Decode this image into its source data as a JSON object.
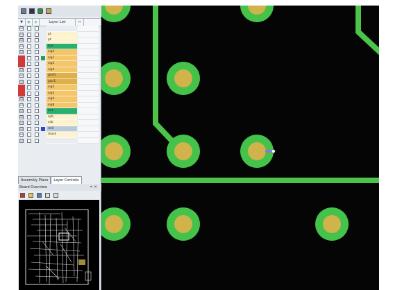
{
  "colors": {
    "board_bg": "#050505",
    "trace": "#4cc44a",
    "pad_ring": "#45c24a",
    "pad_center": "#d0b34b",
    "via_marker": "#8a7ad8"
  },
  "toolbar": {
    "icons": [
      "grid-icon",
      "layers-icon",
      "lock-icon",
      "tag-icon"
    ]
  },
  "layer_panel": {
    "header": {
      "column_name": "Layer List"
    },
    "layers": [
      {
        "name": "",
        "color": "#e9edf2",
        "side": "",
        "swatch": "",
        "v": "☑"
      },
      {
        "name": "pt",
        "color": "#fff2cf",
        "side": "",
        "swatch": "",
        "v": "☑"
      },
      {
        "name": "pt",
        "color": "#fff2cf",
        "side": "",
        "swatch": "",
        "v": "☑"
      },
      {
        "name": "bot",
        "color": "#28b06f",
        "side": "",
        "swatch": "",
        "v": "☑"
      },
      {
        "name": "sig4",
        "color": "#f4c66a",
        "side": "",
        "swatch": "",
        "v": "☑"
      },
      {
        "name": "sig1",
        "color": "#f4c66a",
        "side": "#d23a3a",
        "swatch": "#2e9a4b",
        "v": "☑"
      },
      {
        "name": "sig2",
        "color": "#f4c66a",
        "side": "#d23a3a",
        "swatch": "",
        "v": "☑"
      },
      {
        "name": "sig4",
        "color": "#f4c66a",
        "side": "",
        "swatch": "",
        "v": "☑"
      },
      {
        "name": "gnd1",
        "color": "#ddb04a",
        "side": "",
        "swatch": "",
        "v": "☑"
      },
      {
        "name": "pwr1",
        "color": "#ddb04a",
        "side": "",
        "swatch": "",
        "v": "☑"
      },
      {
        "name": "sig3",
        "color": "#f4c66a",
        "side": "#d23a3a",
        "swatch": "",
        "v": "☑"
      },
      {
        "name": "sig5",
        "color": "#f4c66a",
        "side": "#d23a3a",
        "swatch": "",
        "v": "☑"
      },
      {
        "name": "sig6",
        "color": "#f4c66a",
        "side": "",
        "swatch": "",
        "v": "☑"
      },
      {
        "name": "sig8",
        "color": "#f4c66a",
        "side": "",
        "swatch": "",
        "v": "☑"
      },
      {
        "name": "bot",
        "color": "#28b06f",
        "side": "",
        "swatch": "",
        "v": "☑"
      },
      {
        "name": "spb",
        "color": "#fff2cf",
        "side": "",
        "swatch": "",
        "v": "☑"
      },
      {
        "name": "ssb",
        "color": "#fff2cf",
        "side": "",
        "swatch": "",
        "v": "☑"
      },
      {
        "name": "drill",
        "color": "#b9c8d8",
        "side": "",
        "swatch": "#2b48c8",
        "v": "☑"
      },
      {
        "name": "mask",
        "color": "#fff2cf",
        "side": "",
        "swatch": "",
        "v": "☑"
      },
      {
        "name": "",
        "color": "#e9edf2",
        "side": "",
        "swatch": "",
        "v": "☑"
      }
    ]
  },
  "tabs": [
    "Assembly Plane",
    "Layer Controls"
  ],
  "overview": {
    "title": "Board Overview",
    "pin": "⌖ ×"
  }
}
